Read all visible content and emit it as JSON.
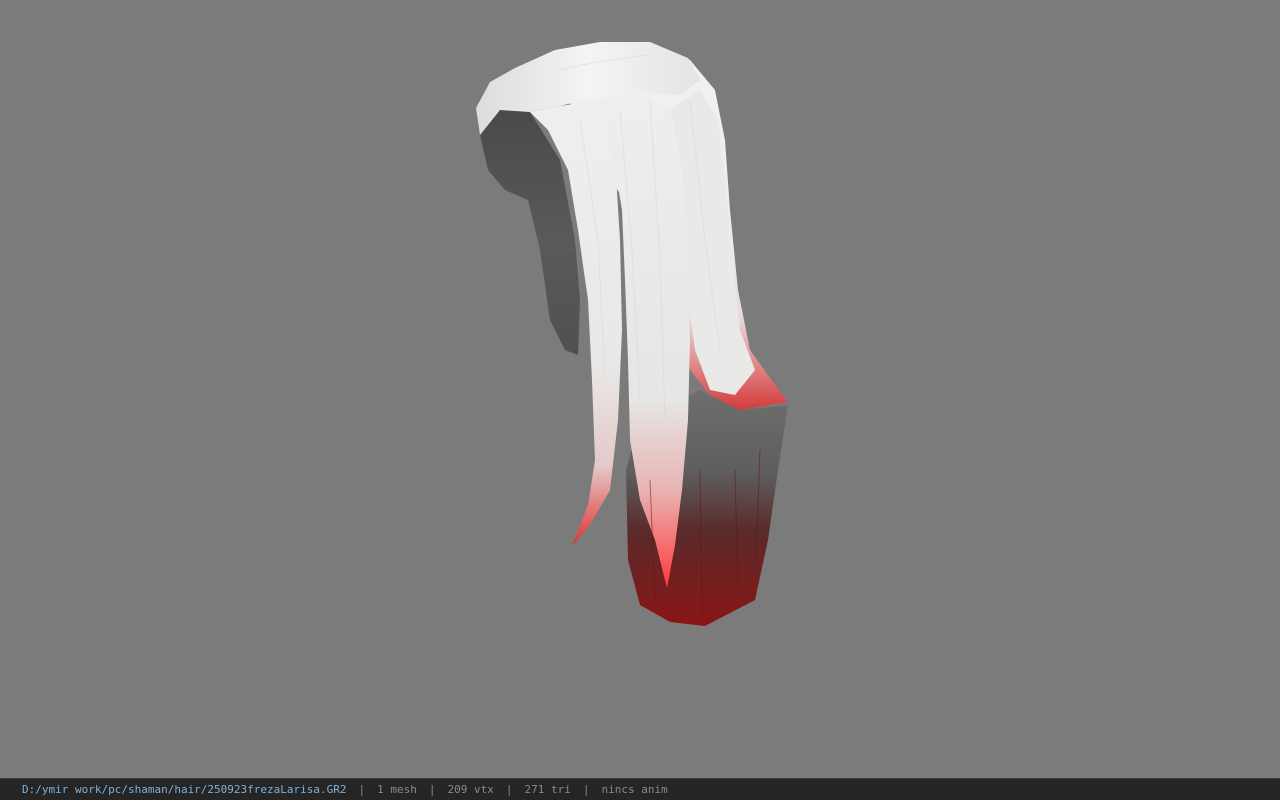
{
  "viewport": {
    "background": "#7b7b7b",
    "model": "hair-mesh"
  },
  "status": {
    "file_path": "D:/ymir work/pc/shaman/hair/250923frezaLarisa.GR2",
    "separator": "|",
    "mesh": "1 mesh",
    "vertices": "209 vtx",
    "triangles": "271 tri",
    "animation": "nincs anim",
    "path_color": "#7fb0d8"
  }
}
